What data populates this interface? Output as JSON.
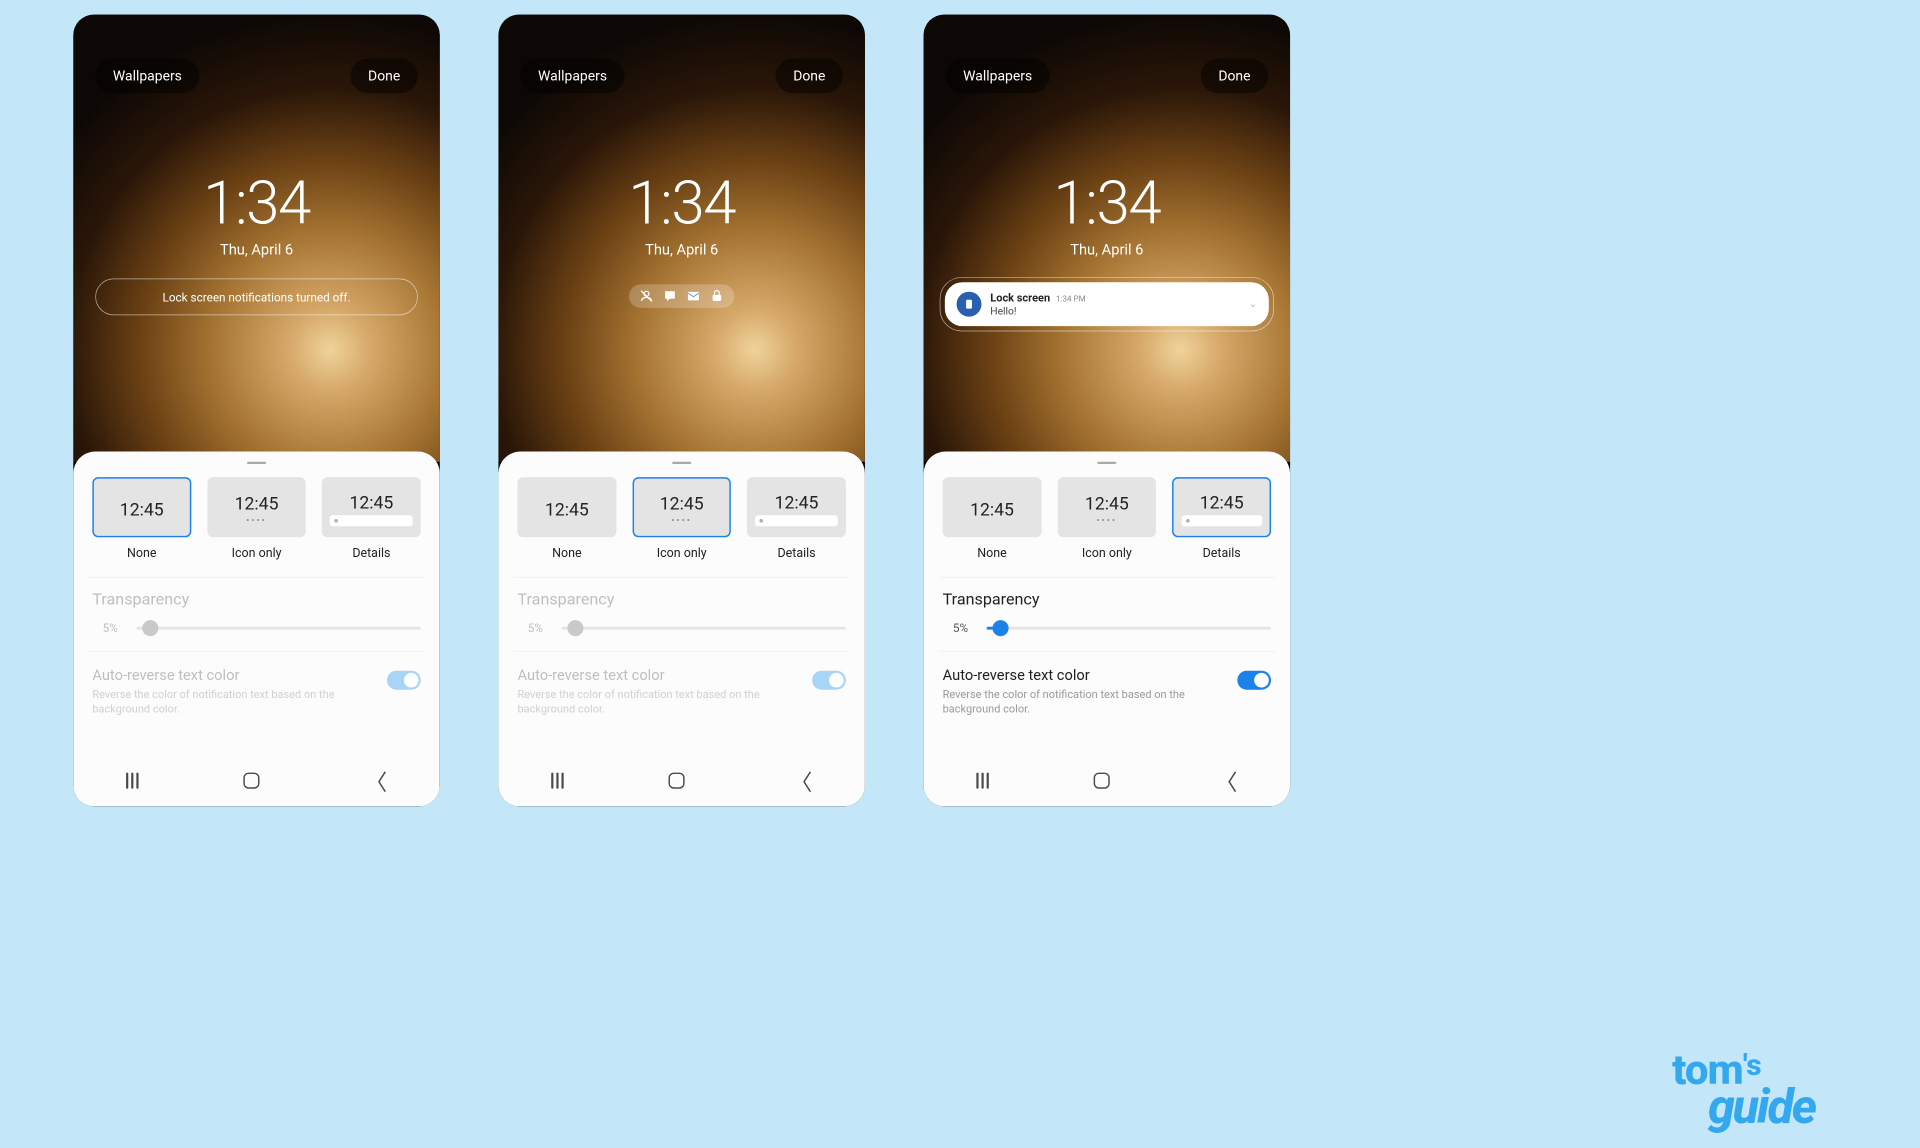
{
  "watermark": {
    "line1": "tom",
    "apostrophe_s": "'s",
    "line2": "guide"
  },
  "common": {
    "wallpapers_btn": "Wallpapers",
    "done_btn": "Done",
    "clock_time": "1:34",
    "clock_date": "Thu, April 6",
    "style_tile_time": "12:45",
    "style_labels": {
      "none": "None",
      "icon_only": "Icon only",
      "details": "Details"
    },
    "transparency_title": "Transparency",
    "transparency_value": "5%",
    "auto_title": "Auto-reverse text color",
    "auto_desc": "Reverse the color of notification text based on the background color.",
    "notif_icons": [
      "user-icon",
      "message-icon",
      "mail-icon",
      "lock-icon"
    ]
  },
  "screens": [
    {
      "variant": "none",
      "selected_style": "none",
      "notif_off_text": "Lock screen notifications turned off.",
      "transparency_enabled": false,
      "auto_reverse_enabled": false
    },
    {
      "variant": "icon_only",
      "selected_style": "icon_only",
      "transparency_enabled": false,
      "auto_reverse_enabled": false
    },
    {
      "variant": "details",
      "selected_style": "details",
      "transparency_enabled": true,
      "auto_reverse_enabled": true,
      "notif_card": {
        "app_name": "Lock screen",
        "time": "1:34 PM",
        "message": "Hello!"
      }
    }
  ]
}
